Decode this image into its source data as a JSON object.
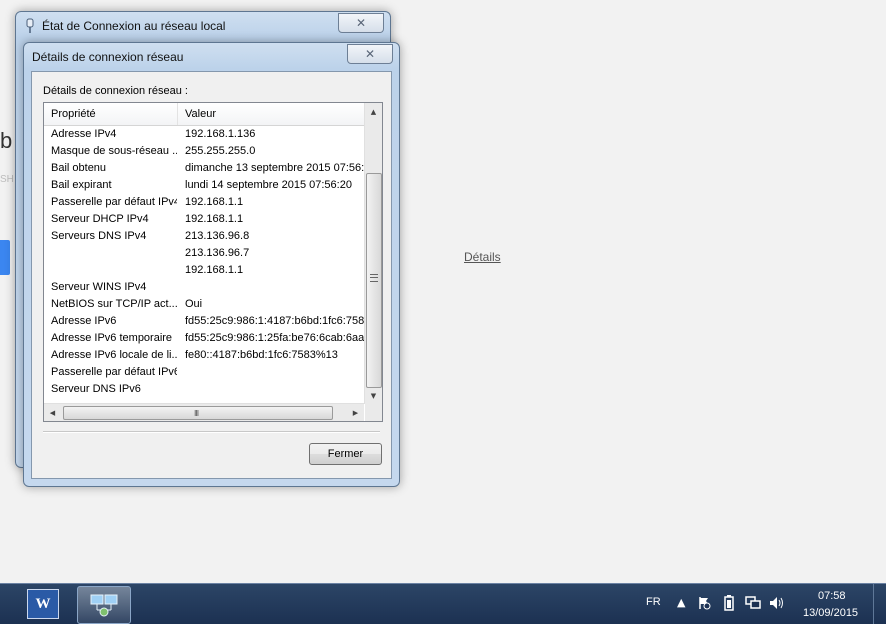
{
  "background": {
    "letter": "b",
    "fragment": "SH",
    "details_link": "Détails"
  },
  "back_window": {
    "title": "État de Connexion au réseau local",
    "close_glyph": "✕"
  },
  "dialog": {
    "title": "Détails de connexion réseau",
    "close_glyph": "✕",
    "group_label": "Détails de connexion réseau :",
    "columns": {
      "property": "Propriété",
      "value": "Valeur"
    },
    "rows": [
      {
        "prop": "Adresse IPv4",
        "val": "192.168.1.136"
      },
      {
        "prop": "Masque de sous-réseau ...",
        "val": "255.255.255.0"
      },
      {
        "prop": "Bail obtenu",
        "val": "dimanche 13 septembre 2015 07:56:2"
      },
      {
        "prop": "Bail expirant",
        "val": "lundi 14 septembre 2015 07:56:20"
      },
      {
        "prop": "Passerelle par défaut IPv4",
        "val": "192.168.1.1"
      },
      {
        "prop": "Serveur DHCP IPv4",
        "val": "192.168.1.1"
      },
      {
        "prop": "Serveurs DNS IPv4",
        "val": "213.136.96.8"
      },
      {
        "prop": "",
        "val": "213.136.96.7"
      },
      {
        "prop": "",
        "val": "192.168.1.1"
      },
      {
        "prop": "Serveur WINS IPv4",
        "val": ""
      },
      {
        "prop": "NetBIOS sur TCP/IP act...",
        "val": "Oui"
      },
      {
        "prop": "Adresse IPv6",
        "val": "fd55:25c9:986:1:4187:b6bd:1fc6:758"
      },
      {
        "prop": "Adresse IPv6 temporaire",
        "val": "fd55:25c9:986:1:25fa:be76:6cab:6aa"
      },
      {
        "prop": "Adresse IPv6 locale de li...",
        "val": "fe80::4187:b6bd:1fc6:7583%13"
      },
      {
        "prop": "Passerelle par défaut IPv6",
        "val": ""
      },
      {
        "prop": "Serveur DNS IPv6",
        "val": ""
      }
    ],
    "scroll_grip_h": "III",
    "close_button": "Fermer"
  },
  "taskbar": {
    "word_glyph": "W",
    "language": "FR",
    "time": "07:58",
    "date": "13/09/2015",
    "tray_icons": [
      "show-hidden-icons-icon",
      "action-center-flag-icon",
      "battery-icon",
      "network-icon",
      "volume-icon"
    ]
  },
  "colors": {
    "desktop_bg": "#f2f2f2",
    "taskbar": "#1c3152",
    "window_frame": "#bcd2ea",
    "link_blue": "#3b86f0"
  }
}
